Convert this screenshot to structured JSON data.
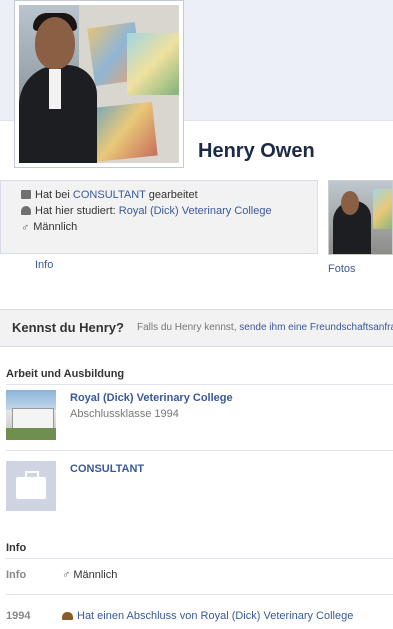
{
  "profile": {
    "name": "Henry Owen"
  },
  "info_box": {
    "work_prefix": "Hat bei ",
    "work_link": "CONSULTANT",
    "work_suffix": " gearbeitet",
    "study_prefix": "Hat hier studiert: ",
    "study_link": "Royal (Dick) Veterinary College",
    "gender": "Männlich"
  },
  "tabs": {
    "info": "Info",
    "fotos": "Fotos"
  },
  "know_bar": {
    "title": "Kennst du Henry?",
    "text": "Falls du Henry kennst, ",
    "link": "sende ihm eine Freundschaftsanfrage"
  },
  "work_education": {
    "heading": "Arbeit und Ausbildung",
    "school": {
      "name": "Royal (Dick) Veterinary College",
      "detail": "Abschlussklasse 1994"
    },
    "employer": {
      "name": "CONSULTANT"
    }
  },
  "info_section": {
    "heading": "Info",
    "rows": [
      {
        "label": "Info",
        "value": "Männlich",
        "icon": "male-icon"
      },
      {
        "label": "1994",
        "value": "Hat einen Abschluss von Royal (Dick) Veterinary College",
        "icon": "graduation-cap-icon"
      }
    ]
  },
  "colors": {
    "link": "#3b5998",
    "name": "#1c2a47",
    "box_bg": "#f2f2f2"
  }
}
